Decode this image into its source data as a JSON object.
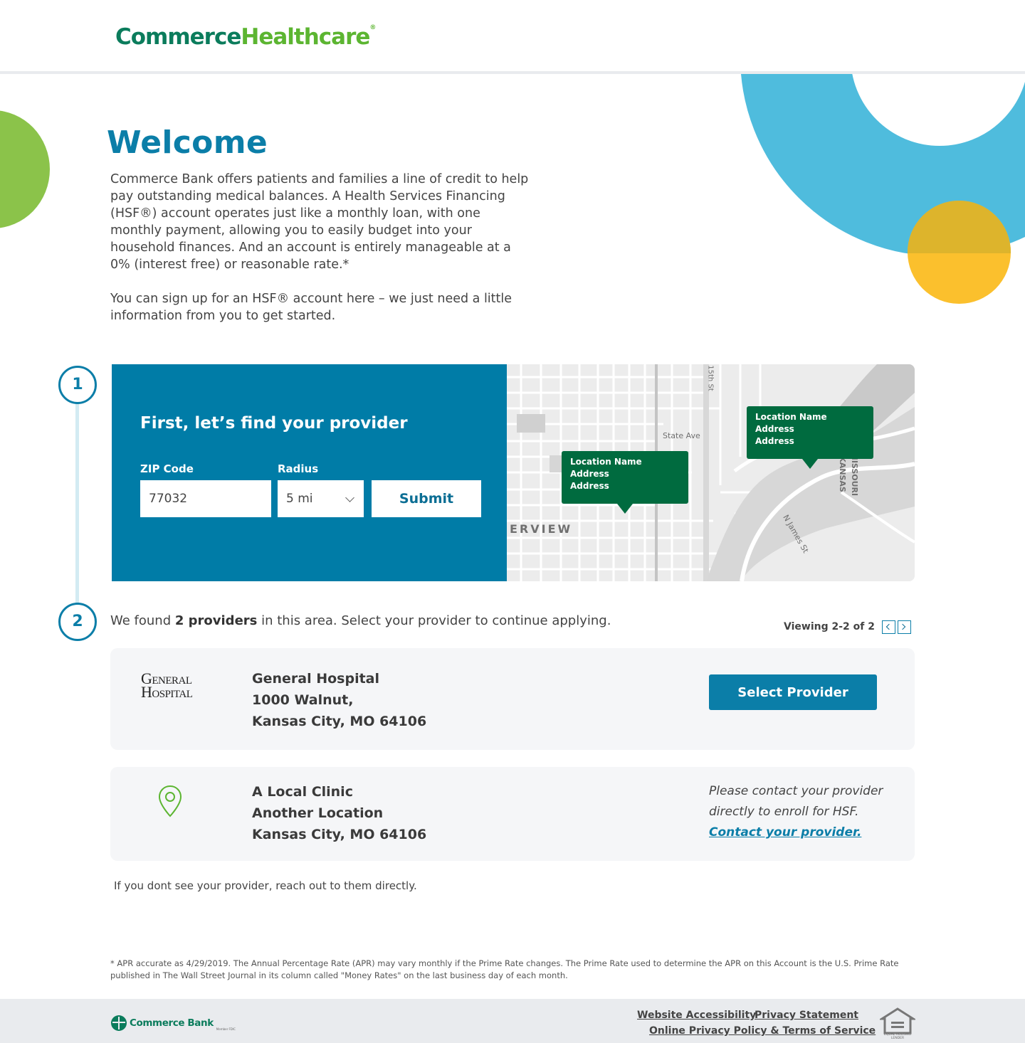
{
  "header": {
    "logo_part1": "Commerce",
    "logo_part2": "Healthcare",
    "logo_mark": "®"
  },
  "welcome": {
    "title": "Welcome",
    "paragraph1": "Commerce Bank offers patients and families a line of credit to help pay outstanding medical balances. A Health Services Financing (HSF®) account operates just like a monthly loan, with one monthly payment, allowing you to easily budget into your household finances. And an account is entirely manageable at a 0% (interest free) or reasonable rate.*",
    "paragraph2": "You can sign up for an HSF® account here – we just need a little information from you to get started."
  },
  "steps": {
    "step1": "1",
    "step2": "2"
  },
  "find": {
    "title": "First, let’s find your provider",
    "zip_label": "ZIP Code",
    "zip_value": "77032",
    "radius_label": "Radius",
    "radius_value": "5 mi",
    "submit_label": "Submit"
  },
  "map": {
    "street_labels": [
      "State Ave",
      "N James St",
      "15th St",
      "ERVIEW",
      "MISSOURI",
      "KANSAS"
    ],
    "pins": [
      {
        "name": "Location Name",
        "line1": "Address",
        "line2": "Address"
      },
      {
        "name": "Location Name",
        "line1": "Address",
        "line2": "Address"
      }
    ]
  },
  "results": {
    "found_prefix": "We found ",
    "found_count": "2 providers",
    "found_suffix": " in this area. Select your provider to continue applying.",
    "viewing": "Viewing 2-2 of 2",
    "providers": [
      {
        "logo_line1": "General",
        "logo_line2": "Hospital",
        "name": "General Hospital",
        "address1": "1000 Walnut,",
        "address2": "Kansas City, MO 64106",
        "action_label": "Select Provider"
      },
      {
        "icon": "location-pin-icon",
        "name": "A Local Clinic",
        "address1": "Another Location",
        "address2": "Kansas City, MO 64106",
        "note": "Please contact your provider directly to enroll for HSF.",
        "link_label": "Contact your provider."
      }
    ],
    "no_see": "If you dont see your provider, reach out to them directly."
  },
  "disclaimer": "* APR accurate as 4/29/2019. The Annual Percentage Rate (APR) may vary monthly if the Prime Rate changes. The Prime Rate used to determine the APR on this Account is the U.S. Prime Rate published in The Wall Street Journal in its column called \"Money Rates\" on the last business day of each month.",
  "footer": {
    "bank_name": "Commerce Bank",
    "bank_sub": "Member FDIC",
    "links": [
      "Website Accessibility",
      "Privacy Statement",
      "Online Privacy Policy & Terms of Service"
    ],
    "ehl_text": "EQUAL HOUSING LENDER"
  },
  "colors": {
    "brand_blue": "#0b7ea8",
    "brand_green": "#0b7c5c",
    "accent_green": "#5cb531",
    "pin_green": "#006b3f",
    "deco_blue": "#4fbcdd",
    "deco_yellow": "#fbc02d"
  }
}
